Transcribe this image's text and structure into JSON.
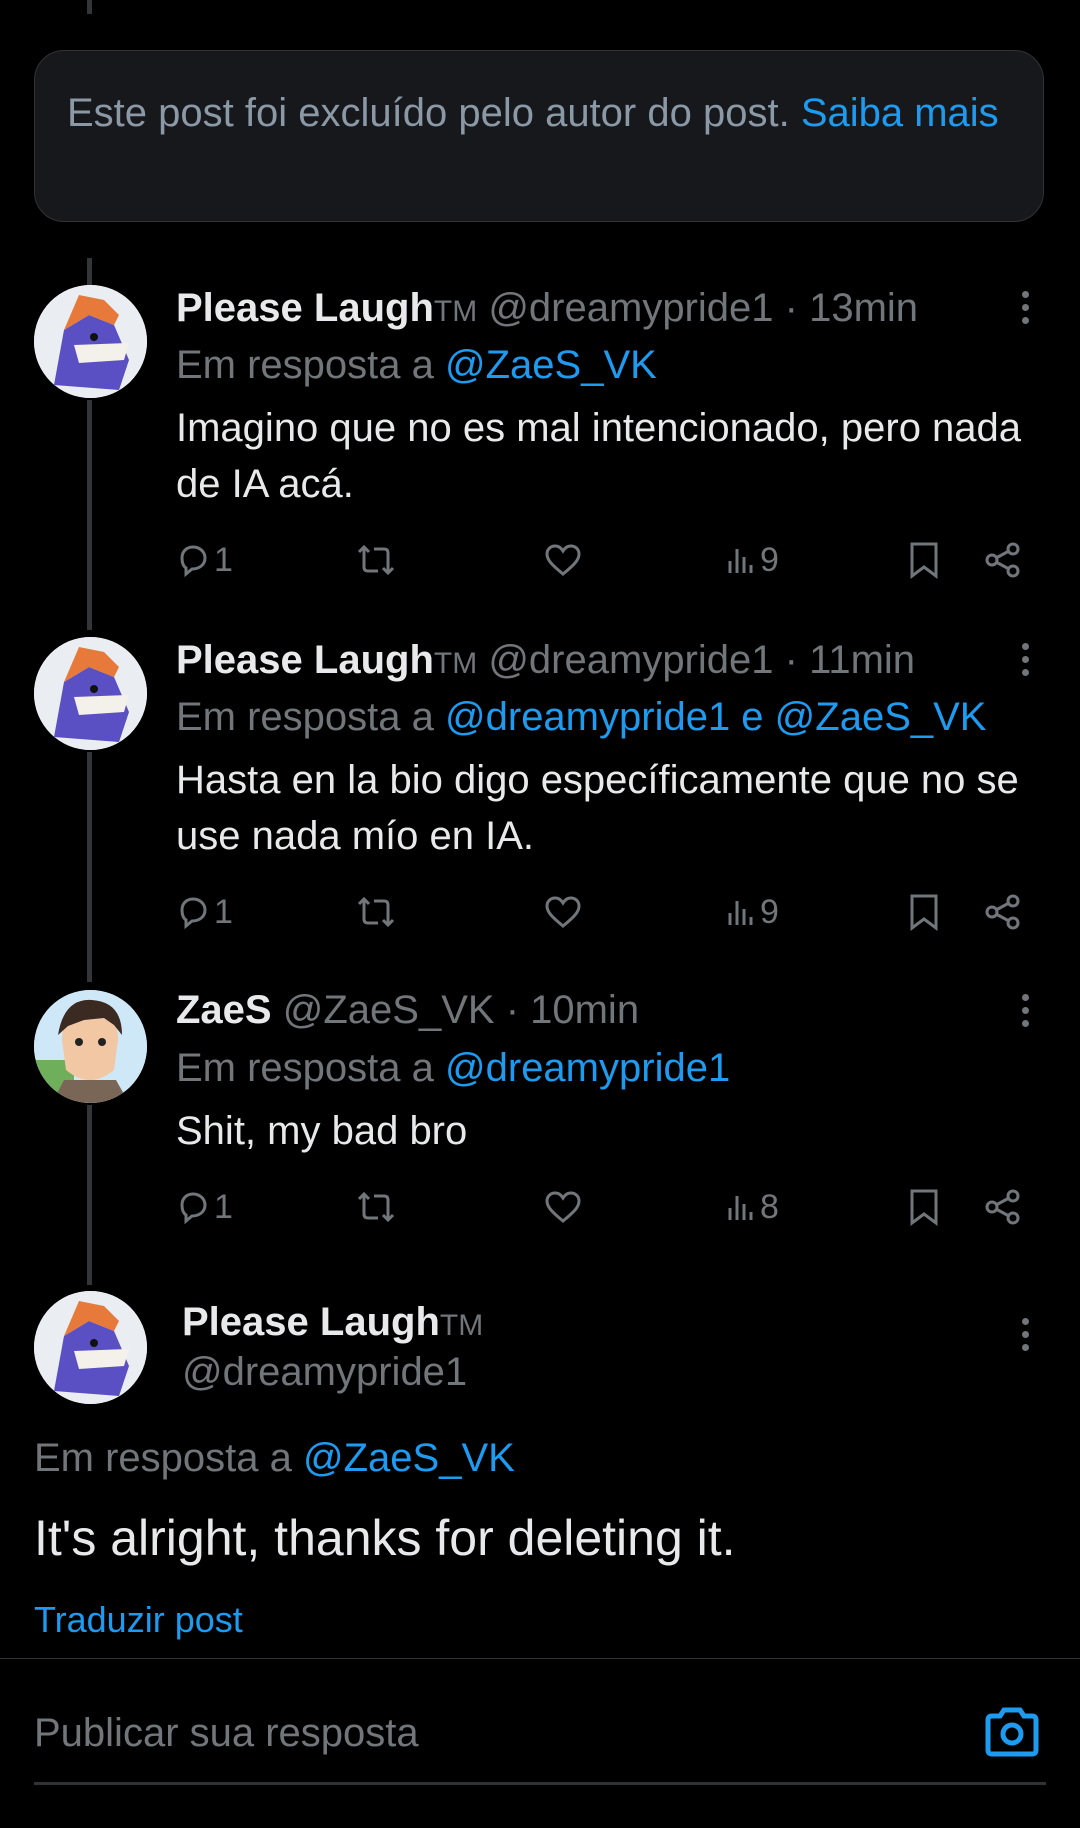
{
  "deleted_notice": {
    "text": "Este post foi excluído pelo autor do post.",
    "link": "Saiba mais"
  },
  "reply_prefix": "Em resposta a",
  "replies": [
    {
      "name": "Please Laugh",
      "badge": "TM",
      "handle": "@dreamypride1",
      "time": "· 13min",
      "reply_to": "@ZaeS_VK",
      "text": "Imagino que no es mal intencionado, pero nada de IA acá.",
      "replies": "1",
      "views": "9"
    },
    {
      "name": "Please Laugh",
      "badge": "TM",
      "handle": "@dreamypride1",
      "time": "· 11min",
      "reply_to": "@dreamypride1 e @ZaeS_VK",
      "text": "Hasta en la bio digo específicamente que no se use nada mío en IA.",
      "replies": "1",
      "views": "9"
    },
    {
      "name": "ZaeS",
      "badge": "",
      "handle": "@ZaeS_VK",
      "time": "· 10min",
      "reply_to": "@dreamypride1",
      "text": "Shit, my bad bro",
      "replies": "1",
      "views": "8"
    }
  ],
  "main_post": {
    "name": "Please Laugh",
    "badge": "TM",
    "handle": "@dreamypride1",
    "reply_to": "@ZaeS_VK",
    "text": "It's alright, thanks for deleting it.",
    "translate": "Traduzir post"
  },
  "composer": {
    "placeholder": "Publicar sua resposta",
    "icon": "camera-icon"
  },
  "colors": {
    "accent": "#1d9bf0",
    "muted": "#71767b",
    "text": "#e7e9ea",
    "bg": "#000000"
  }
}
